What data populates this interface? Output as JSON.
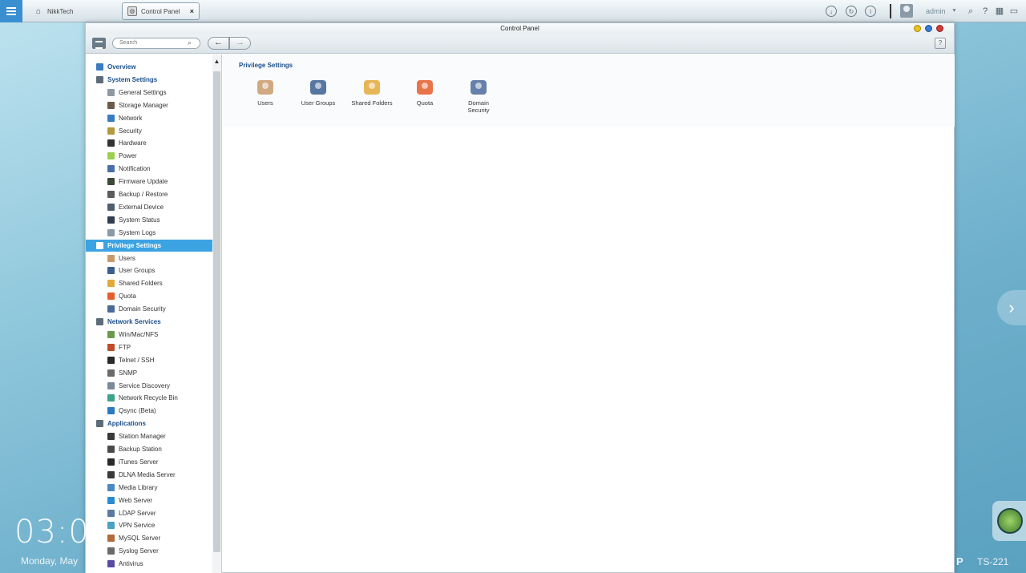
{
  "taskbar": {
    "home_tab_label": "NikkTech",
    "active_tab_label": "Control Panel",
    "user_name": "admin"
  },
  "window": {
    "title": "Control Panel",
    "search_placeholder": "Search"
  },
  "sidebar": {
    "items": [
      {
        "label": "Overview",
        "kind": "cat",
        "icon": "overview-icon",
        "color": "#3a7cc2"
      },
      {
        "label": "System Settings",
        "kind": "cat",
        "icon": "gear-icon",
        "color": "#5c6c7a"
      },
      {
        "label": "General Settings",
        "kind": "sub",
        "icon": "general-settings-icon",
        "color": "#8e9aa3"
      },
      {
        "label": "Storage Manager",
        "kind": "sub",
        "icon": "storage-icon",
        "color": "#6e5a4a"
      },
      {
        "label": "Network",
        "kind": "sub",
        "icon": "network-icon",
        "color": "#3a7cc2"
      },
      {
        "label": "Security",
        "kind": "sub",
        "icon": "lock-icon",
        "color": "#b49a3c"
      },
      {
        "label": "Hardware",
        "kind": "sub",
        "icon": "hardware-icon",
        "color": "#333333"
      },
      {
        "label": "Power",
        "kind": "sub",
        "icon": "bulb-icon",
        "color": "#9ccf4f"
      },
      {
        "label": "Notification",
        "kind": "sub",
        "icon": "notification-icon",
        "color": "#4a6fa8"
      },
      {
        "label": "Firmware Update",
        "kind": "sub",
        "icon": "firmware-icon",
        "color": "#3b4a35"
      },
      {
        "label": "Backup / Restore",
        "kind": "sub",
        "icon": "backup-icon",
        "color": "#5c5c5c"
      },
      {
        "label": "External Device",
        "kind": "sub",
        "icon": "external-device-icon",
        "color": "#4f5f6f"
      },
      {
        "label": "System Status",
        "kind": "sub",
        "icon": "monitor-icon",
        "color": "#2f3f4f"
      },
      {
        "label": "System Logs",
        "kind": "sub",
        "icon": "logs-icon",
        "color": "#8a9aa6"
      },
      {
        "label": "Privilege Settings",
        "kind": "cat",
        "icon": "person-icon",
        "color": "#1e5f9e",
        "active": true
      },
      {
        "label": "Users",
        "kind": "sub",
        "icon": "user-icon",
        "color": "#c89a6a"
      },
      {
        "label": "User Groups",
        "kind": "sub",
        "icon": "user-groups-icon",
        "color": "#3a5f8f"
      },
      {
        "label": "Shared Folders",
        "kind": "sub",
        "icon": "folder-icon",
        "color": "#e2a93a"
      },
      {
        "label": "Quota",
        "kind": "sub",
        "icon": "quota-icon",
        "color": "#e65c2a"
      },
      {
        "label": "Domain Security",
        "kind": "sub",
        "icon": "domain-security-icon",
        "color": "#4a6a9a"
      },
      {
        "label": "Network Services",
        "kind": "cat",
        "icon": "globe-icon",
        "color": "#5c6c7a"
      },
      {
        "label": "Win/Mac/NFS",
        "kind": "sub",
        "icon": "win-mac-nfs-icon",
        "color": "#6a9a4a"
      },
      {
        "label": "FTP",
        "kind": "sub",
        "icon": "ftp-icon",
        "color": "#c24a2a"
      },
      {
        "label": "Telnet / SSH",
        "kind": "sub",
        "icon": "terminal-icon",
        "color": "#2a2a2a"
      },
      {
        "label": "SNMP",
        "kind": "sub",
        "icon": "snmp-icon",
        "color": "#6a6a6a"
      },
      {
        "label": "Service Discovery",
        "kind": "sub",
        "icon": "service-discovery-icon",
        "color": "#7a8a9a"
      },
      {
        "label": "Network Recycle Bin",
        "kind": "sub",
        "icon": "recycle-bin-icon",
        "color": "#3aa38a"
      },
      {
        "label": "Qsync (Beta)",
        "kind": "sub",
        "icon": "qsync-icon",
        "color": "#2a7ac2"
      },
      {
        "label": "Applications",
        "kind": "cat",
        "icon": "applications-icon",
        "color": "#5c6c7a"
      },
      {
        "label": "Station Manager",
        "kind": "sub",
        "icon": "station-manager-icon",
        "color": "#3a3a3a"
      },
      {
        "label": "Backup Station",
        "kind": "sub",
        "icon": "backup-station-icon",
        "color": "#4a4a4a"
      },
      {
        "label": "iTunes Server",
        "kind": "sub",
        "icon": "itunes-icon",
        "color": "#2a2a2a"
      },
      {
        "label": "DLNA Media Server",
        "kind": "sub",
        "icon": "dlna-icon",
        "color": "#3a3a3a"
      },
      {
        "label": "Media Library",
        "kind": "sub",
        "icon": "media-library-icon",
        "color": "#4a8ac2"
      },
      {
        "label": "Web Server",
        "kind": "sub",
        "icon": "web-server-icon",
        "color": "#2a8ad2"
      },
      {
        "label": "LDAP Server",
        "kind": "sub",
        "icon": "ldap-icon",
        "color": "#5a7aa2"
      },
      {
        "label": "VPN Service",
        "kind": "sub",
        "icon": "vpn-icon",
        "color": "#4aa2c2"
      },
      {
        "label": "MySQL Server",
        "kind": "sub",
        "icon": "mysql-icon",
        "color": "#b26a3a"
      },
      {
        "label": "Syslog Server",
        "kind": "sub",
        "icon": "syslog-icon",
        "color": "#6a6a6a"
      },
      {
        "label": "Antivirus",
        "kind": "sub",
        "icon": "antivirus-icon",
        "color": "#5a4aa2"
      }
    ]
  },
  "content": {
    "section_title": "Privilege Settings",
    "tiles": [
      {
        "label1": "Users",
        "label2": "",
        "icon": "user-icon",
        "color": "#c89a6a"
      },
      {
        "label1": "User Groups",
        "label2": "",
        "icon": "user-groups-icon",
        "color": "#3a5f8f"
      },
      {
        "label1": "Shared Folders",
        "label2": "",
        "icon": "folder-icon",
        "color": "#e2a93a"
      },
      {
        "label1": "Quota",
        "label2": "",
        "icon": "quota-icon",
        "color": "#e65c2a"
      },
      {
        "label1": "Domain",
        "label2": "Security",
        "icon": "domain-security-icon",
        "color": "#4a6a9a"
      }
    ]
  },
  "desktop": {
    "clock": "03:0",
    "date": "Monday, May",
    "brand": "P",
    "model": "TS-221"
  }
}
